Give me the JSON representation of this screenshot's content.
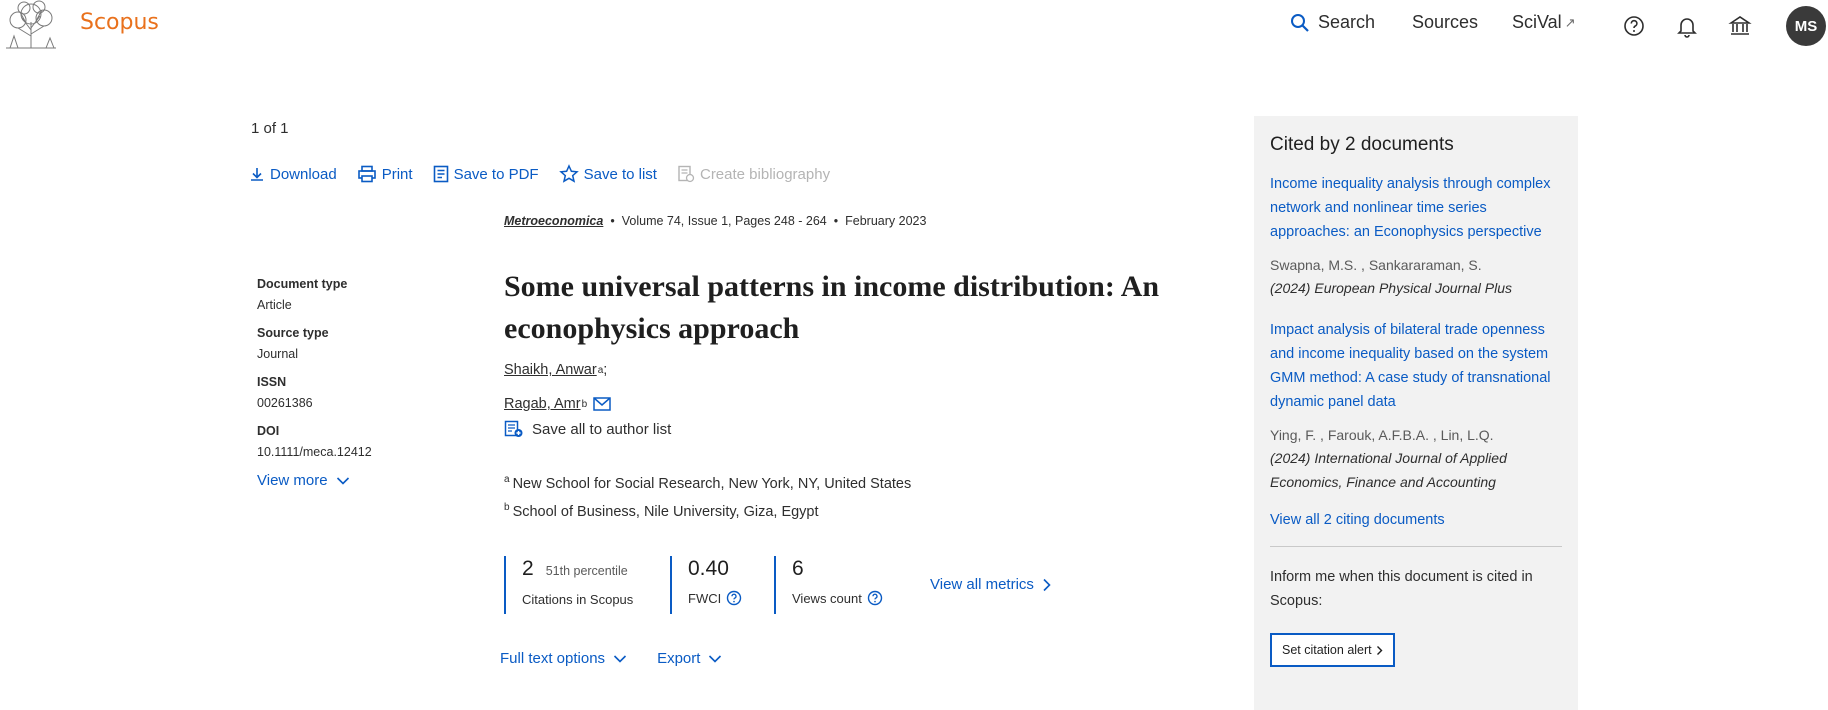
{
  "header": {
    "brand": "Scopus",
    "nav": {
      "search": "Search",
      "sources": "Sources",
      "scival": "SciVal",
      "scival_ext": "↗"
    },
    "avatar_initials": "MS"
  },
  "pager": "1 of 1",
  "toolbar": {
    "download": "Download",
    "print": "Print",
    "save_pdf": "Save to PDF",
    "save_list": "Save to list",
    "create_bib": "Create bibliography"
  },
  "source": {
    "journal": "Metroeconomica",
    "volume": "Volume 74, Issue 1, Pages 248 - 264",
    "date": "February 2023",
    "sep": "•"
  },
  "meta": {
    "doc_type_label": "Document type",
    "doc_type": "Article",
    "source_type_label": "Source type",
    "source_type": "Journal",
    "issn_label": "ISSN",
    "issn": "00261386",
    "doi_label": "DOI",
    "doi": "10.1111/meca.12412",
    "view_more": "View more"
  },
  "document": {
    "title": "Some universal patterns in income distribution: An econophysics approach",
    "authors": [
      {
        "name": "Shaikh, Anwar",
        "sup": "a",
        "suffix": ";"
      },
      {
        "name": "Ragab, Amr",
        "sup": "b"
      }
    ],
    "save_authors": "Save all to author list",
    "affiliations": [
      {
        "sup": "a",
        "text": "New School for Social Research, New York, NY, United States"
      },
      {
        "sup": "b",
        "text": "School of Business, Nile University, Giza, Egypt"
      }
    ]
  },
  "metrics": {
    "citations": "2",
    "percentile": "51th percentile",
    "citations_label": "Citations in Scopus",
    "fwci": "0.40",
    "fwci_label": "FWCI",
    "views": "6",
    "views_label": "Views count",
    "view_all": "View all metrics"
  },
  "options": {
    "full_text": "Full text options",
    "export": "Export"
  },
  "cited_by": {
    "heading": "Cited by 2 documents",
    "items": [
      {
        "title": "Income inequality analysis through complex network and nonlinear time series approaches: an Econophysics perspective",
        "authors": "Swapna, M.S. , Sankararaman, S.",
        "year": "(2024)",
        "journal": "European Physical Journal Plus"
      },
      {
        "title": "Impact analysis of bilateral trade openness and income inequality based on the system GMM method: A case study of transnational dynamic panel data",
        "authors": "Ying, F. , Farouk, A.F.B.A. , Lin, L.Q.",
        "year": "(2024)",
        "journal": "International Journal of Applied Economics, Finance and Accounting"
      }
    ],
    "view_all": "View all 2 citing documents",
    "inform": "Inform me when this document is cited in Scopus:",
    "alert_button": "Set citation alert"
  },
  "colors": {
    "brand_orange": "#e9711c",
    "link_blue": "#0a5bc4",
    "panel_bg": "#f2f2f2",
    "avatar_bg": "#3a3a3a"
  },
  "icons": {
    "search": "search-icon",
    "help": "help-circle-icon",
    "bell": "bell-icon",
    "institution": "institution-icon",
    "download": "download-icon",
    "print": "printer-icon",
    "pdf": "pdf-icon",
    "star": "star-icon",
    "bibliography": "bibliography-icon",
    "email": "envelope-icon",
    "author_list": "author-list-icon",
    "chevron": "chevron-down-icon",
    "info": "info-circle-icon"
  }
}
